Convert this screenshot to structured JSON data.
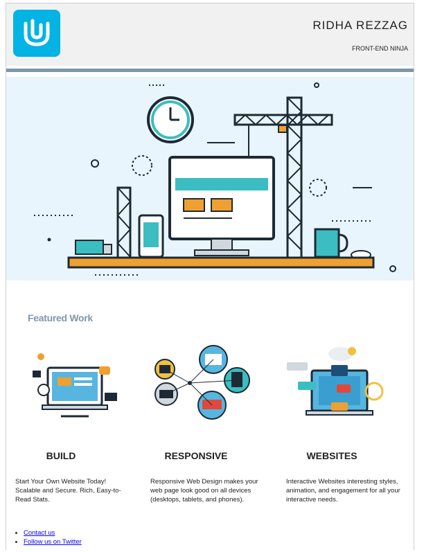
{
  "header": {
    "name": "RIDHA REZZAG",
    "subtitle": "FRONT-END NINJA",
    "logo_icon": "udacity-logo-icon",
    "logo_color": "#02b3e4"
  },
  "hero": {
    "icon": "website-under-construction-illustration",
    "background": "#e8f5fc"
  },
  "featured": {
    "title": "Featured Work",
    "cards": [
      {
        "icon": "build-illustration-icon",
        "title": "BUILD",
        "text": "Start Your Own Website Today! Scalable and Secure. Rich, Easy-to-Read Stats."
      },
      {
        "icon": "responsive-illustration-icon",
        "title": "RESPONSIVE",
        "text": "Responsive Web Design makes your web page look good on all devices (desktops, tablets, and phones)."
      },
      {
        "icon": "websites-illustration-icon",
        "title": "WEBSITES",
        "text": "Interactive Websites interesting styles, animation, and engagement for all your interactive needs."
      }
    ]
  },
  "footer": {
    "links": [
      "Contact us",
      "Follow us on Twitter"
    ]
  }
}
